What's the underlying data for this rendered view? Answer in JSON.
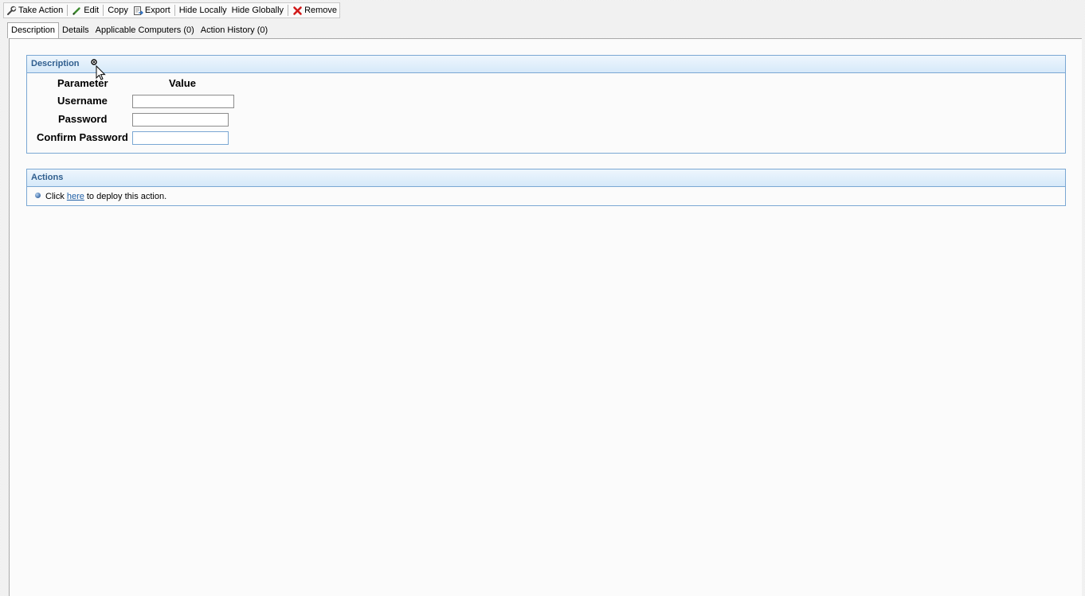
{
  "toolbar": {
    "take_action": "Take Action",
    "edit": "Edit",
    "copy": "Copy",
    "export": "Export",
    "hide_locally": "Hide Locally",
    "hide_globally": "Hide Globally",
    "remove": "Remove"
  },
  "tabs": [
    {
      "label": "Description",
      "active": true
    },
    {
      "label": "Details",
      "active": false
    },
    {
      "label": "Applicable Computers (0)",
      "active": false
    },
    {
      "label": "Action History (0)",
      "active": false
    }
  ],
  "description_section": {
    "title": "Description",
    "column_parameter": "Parameter",
    "column_value": "Value",
    "fields": [
      {
        "label": "Username",
        "value": ""
      },
      {
        "label": "Password",
        "value": ""
      },
      {
        "label": "Confirm Password",
        "value": ""
      }
    ]
  },
  "actions_section": {
    "title": "Actions",
    "line_prefix": "Click",
    "link_text": "here",
    "line_suffix": "to deploy this action."
  },
  "colors": {
    "section_header_text": "#2f5e8e",
    "section_border": "#7aa7d3",
    "link": "#1f5fa6",
    "remove_icon": "#d11a1a"
  },
  "icons": {
    "take_action": "wrench-icon",
    "edit": "pencil-icon",
    "export": "export-icon",
    "remove": "red-x-icon",
    "bullet": "blue-dot-icon"
  }
}
